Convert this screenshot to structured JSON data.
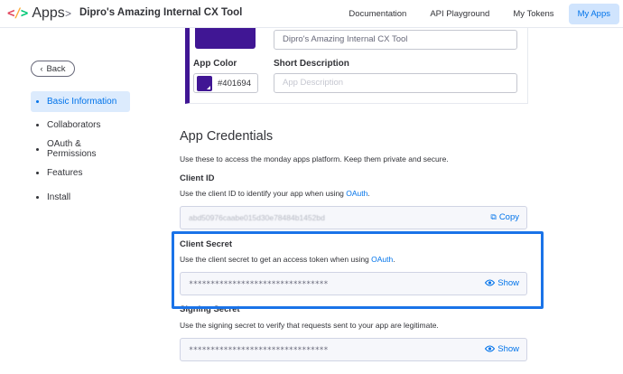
{
  "header": {
    "logo_glyph_lt": "<",
    "logo_glyph_sl": "/",
    "logo_glyph_gt": ">",
    "logo_text": "Apps",
    "separator": ">",
    "app_title": "Dipro's Amazing Internal CX Tool",
    "nav": [
      {
        "label": "Documentation"
      },
      {
        "label": "API Playground"
      },
      {
        "label": "My Tokens"
      },
      {
        "label": "My Apps"
      }
    ]
  },
  "sidebar": {
    "back_label": "Back",
    "items": [
      {
        "label": "Basic Information"
      },
      {
        "label": "Collaborators"
      },
      {
        "label": "OAuth & Permissions"
      },
      {
        "label": "Features"
      },
      {
        "label": "Install"
      }
    ]
  },
  "basic_info": {
    "app_name_value": "Dipro's Amazing Internal CX Tool",
    "app_color_label": "App Color",
    "app_color_hex": "#401694",
    "short_description_label": "Short Description",
    "short_description_placeholder": "App Description"
  },
  "credentials": {
    "title": "App Credentials",
    "description": "Use these to access the monday apps platform. Keep them private and secure.",
    "client_id": {
      "label": "Client ID",
      "desc_prefix": "Use the client ID to identify your app when using ",
      "desc_link": "OAuth",
      "desc_suffix": ".",
      "value": "abd50976caabe015d30e78484b1452bd",
      "action_label": "Copy"
    },
    "client_secret": {
      "label": "Client Secret",
      "desc_prefix": "Use the client secret to get an access token when using ",
      "desc_link": "OAuth",
      "desc_suffix": ".",
      "value": "********************************",
      "action_label": "Show"
    },
    "signing_secret": {
      "label": "Signing Secret",
      "description": "Use the signing secret to verify that requests sent to your app are legitimate.",
      "value": "********************************",
      "action_label": "Show"
    }
  },
  "colors": {
    "accent": "#0073ea",
    "app_color": "#401694",
    "highlight": "#1a73e8"
  }
}
